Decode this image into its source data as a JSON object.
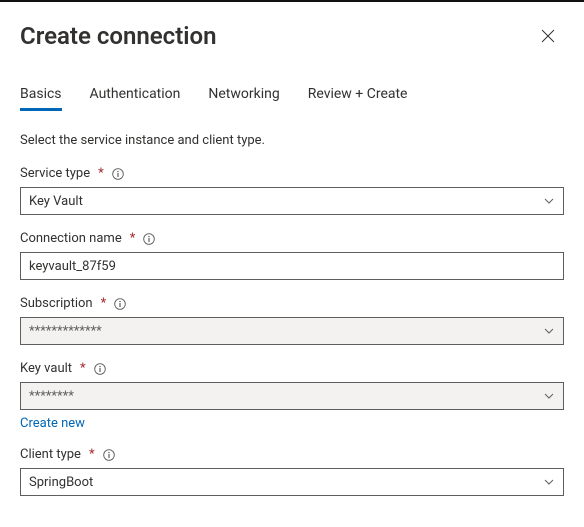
{
  "header": {
    "title": "Create connection"
  },
  "tabs": {
    "items": [
      {
        "label": "Basics"
      },
      {
        "label": "Authentication"
      },
      {
        "label": "Networking"
      },
      {
        "label": "Review + Create"
      }
    ],
    "activeIndex": 0
  },
  "instruction": "Select the service instance and client type.",
  "fields": {
    "serviceType": {
      "label": "Service type",
      "required": "*",
      "value": "Key Vault"
    },
    "connectionName": {
      "label": "Connection name",
      "required": "*",
      "value": "keyvault_87f59"
    },
    "subscription": {
      "label": "Subscription",
      "required": "*",
      "value": "*************"
    },
    "keyVault": {
      "label": "Key vault",
      "required": "*",
      "value": "********",
      "createNew": "Create new"
    },
    "clientType": {
      "label": "Client type",
      "required": "*",
      "value": "SpringBoot"
    }
  }
}
